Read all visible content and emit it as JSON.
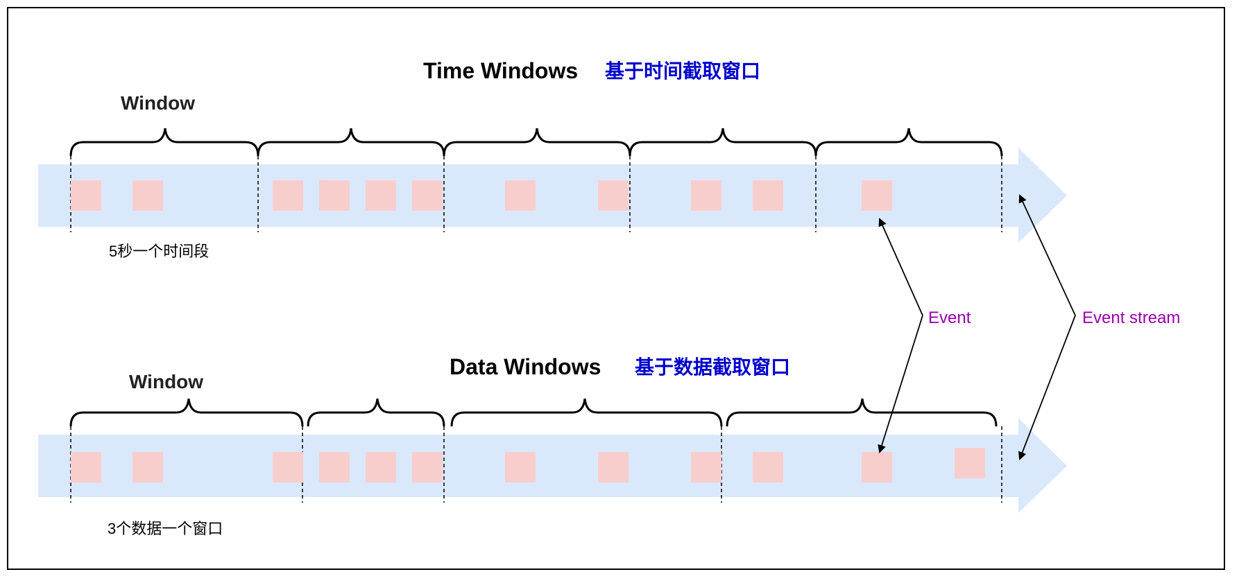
{
  "colors": {
    "stream": "#dae8fc",
    "event": "#f8cecc",
    "accent_blue": "#0000cc",
    "accent_purple": "#9900aa",
    "line": "#000000"
  },
  "time_windows": {
    "title": "Time Windows",
    "title_cn": "基于时间截取窗口",
    "window_label": "Window",
    "caption": "5秒一个时间段",
    "windows": 5,
    "events_per_window": [
      2,
      4,
      2,
      2,
      1
    ]
  },
  "data_windows": {
    "title": "Data Windows",
    "title_cn": "基于数据截取窗口",
    "window_label": "Window",
    "caption": "3个数据一个窗口",
    "windows": 4,
    "events_per_window": [
      3,
      3,
      3,
      3
    ]
  },
  "annotations": {
    "event": "Event",
    "event_stream": "Event stream"
  }
}
